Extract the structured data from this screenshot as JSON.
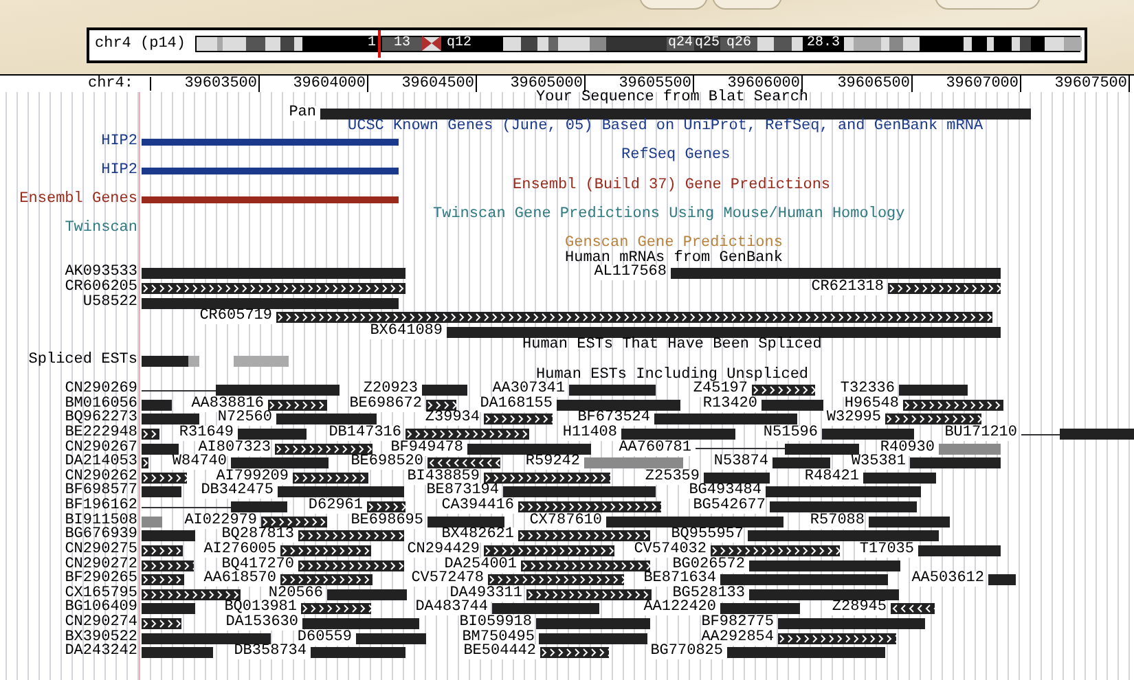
{
  "ideogram": {
    "label": "chr4 (p14)",
    "bands": [
      "1",
      "13",
      "q12",
      "q24",
      "q25",
      "q26",
      "28.3"
    ]
  },
  "ruler": {
    "label": "chr4:",
    "ticks": [
      "39603500",
      "39604000",
      "39604500",
      "39605000",
      "39605500",
      "39606000",
      "39606500",
      "39607000",
      "39607500"
    ]
  },
  "rows": [
    {
      "kind": "title",
      "text": "Your Sequence from Blat Search",
      "color": "#000000"
    },
    {
      "kind": "features",
      "items": [
        {
          "label": "Pan",
          "kind": "solid"
        }
      ]
    },
    {
      "kind": "title",
      "text": "UCSC Known Genes (June, 05) Based on UniProt, RefSeq, and GenBank mRNA",
      "color": "#1c3a8c"
    },
    {
      "kind": "features",
      "label": "HIP2",
      "color": "#1c3a8c",
      "items": [
        {
          "kind": "gene"
        }
      ]
    },
    {
      "kind": "title",
      "text": "RefSeq Genes",
      "color": "#1c3a8c"
    },
    {
      "kind": "features",
      "label": "HIP2",
      "color": "#1c3a8c",
      "items": [
        {
          "kind": "gene"
        }
      ]
    },
    {
      "kind": "title",
      "text": "Ensembl (Build 37) Gene Predictions",
      "color": "#9a2a1c"
    },
    {
      "kind": "features",
      "label": "Ensembl Genes",
      "color": "#9a2a1c",
      "items": [
        {
          "kind": "gene"
        }
      ]
    },
    {
      "kind": "title",
      "text": "Twinscan Gene Predictions Using Mouse/Human Homology",
      "color": "#2e7a80"
    },
    {
      "kind": "features",
      "label": "Twinscan",
      "color": "#2e7a80",
      "items": []
    },
    {
      "kind": "title",
      "text": "Genscan Gene Predictions",
      "color": "#b8823c"
    },
    {
      "kind": "title",
      "text": "Human mRNAs from GenBank",
      "color": "#000000"
    },
    {
      "kind": "features",
      "label": "AK093533",
      "items": [
        {
          "kind": "solid"
        },
        {
          "label": "AL117568",
          "kind": "solid"
        }
      ]
    },
    {
      "kind": "features",
      "label": "CR606205",
      "items": [
        {
          "kind": "fwd"
        },
        {
          "label": "CR621318",
          "kind": "fwd"
        }
      ]
    },
    {
      "kind": "features",
      "label": "U58522",
      "items": [
        {
          "kind": "solid"
        }
      ]
    },
    {
      "kind": "features",
      "items": [
        {
          "label": "CR605719",
          "kind": "fwd"
        }
      ]
    },
    {
      "kind": "features",
      "items": [
        {
          "label": "BX641089",
          "kind": "solid"
        }
      ]
    },
    {
      "kind": "title",
      "text": "Human ESTs That Have Been Spliced",
      "color": "#000000"
    },
    {
      "kind": "features",
      "label": "Spliced ESTs",
      "items": [
        {
          "kind": "solid"
        },
        {
          "kind": "gray"
        },
        {
          "kind": "gray"
        }
      ]
    },
    {
      "kind": "title",
      "text": "Human ESTs Including Unspliced",
      "color": "#000000"
    },
    {
      "kind": "features",
      "label": "CN290269",
      "items": [
        {
          "kind": "line"
        },
        {
          "label": "Z20923",
          "kind": "solid"
        },
        {
          "label": "AA307341",
          "kind": "solid"
        },
        {
          "label": "Z45197",
          "kind": "fwd"
        },
        {
          "label": "T32336",
          "kind": "solid"
        }
      ]
    },
    {
      "kind": "features",
      "label": "BM016056",
      "items": [
        {
          "kind": "solid"
        },
        {
          "label": "AA838816",
          "kind": "fwd"
        },
        {
          "label": "BE698672",
          "kind": "fwd"
        },
        {
          "label": "DA168155",
          "kind": "solid"
        },
        {
          "label": "R13420",
          "kind": "solid"
        },
        {
          "label": "H96548",
          "kind": "fwd"
        }
      ]
    },
    {
      "kind": "features",
      "label": "BQ962273",
      "items": [
        {
          "kind": "solid"
        },
        {
          "label": "N72560",
          "kind": "solid"
        },
        {
          "label": "Z39934",
          "kind": "fwd"
        },
        {
          "label": "BF673524",
          "kind": "solid"
        },
        {
          "label": "W32995",
          "kind": "fwd"
        }
      ]
    },
    {
      "kind": "features",
      "label": "BE222948",
      "items": [
        {
          "kind": "fwd"
        },
        {
          "label": "R31649",
          "kind": "solid"
        },
        {
          "label": "DB147316",
          "kind": "fwd"
        },
        {
          "label": "H11408",
          "kind": "solid"
        },
        {
          "label": "N51596",
          "kind": "solid"
        },
        {
          "label": "BU171210",
          "kind": "line"
        }
      ]
    },
    {
      "kind": "features",
      "label": "CN290267",
      "items": [
        {
          "kind": "solid"
        },
        {
          "label": "AI807323",
          "kind": "fwd"
        },
        {
          "label": "BF949478",
          "kind": "solid"
        },
        {
          "label": "AA760781",
          "kind": "line"
        },
        {
          "label": "R40930",
          "kind": "gray"
        }
      ]
    },
    {
      "kind": "features",
      "label": "DA214053",
      "items": [
        {
          "kind": "fwd"
        },
        {
          "label": "W84740",
          "kind": "solid"
        },
        {
          "label": "BE698520",
          "kind": "rev"
        },
        {
          "label": "R59242",
          "kind": "gray"
        },
        {
          "label": "N53874",
          "kind": "solid"
        },
        {
          "label": "W35381",
          "kind": "solid"
        }
      ]
    },
    {
      "kind": "features",
      "label": "CN290262",
      "items": [
        {
          "kind": "fwd"
        },
        {
          "label": "AI799209",
          "kind": "fwd"
        },
        {
          "label": "BI438859",
          "kind": "fwd"
        },
        {
          "label": "Z25359",
          "kind": "solid"
        },
        {
          "label": "R48421",
          "kind": "solid"
        }
      ]
    },
    {
      "kind": "features",
      "label": "BF698577",
      "items": [
        {
          "kind": "solid"
        },
        {
          "label": "DB342475",
          "kind": "solid"
        },
        {
          "label": "BE873194",
          "kind": "solid"
        },
        {
          "label": "BG493484",
          "kind": "solid"
        }
      ]
    },
    {
      "kind": "features",
      "label": "BF196162",
      "items": [
        {
          "kind": "line"
        },
        {
          "label": "D62961",
          "kind": "fwd"
        },
        {
          "label": "CA394416",
          "kind": "fwd"
        },
        {
          "label": "BG542677",
          "kind": "solid"
        }
      ]
    },
    {
      "kind": "features",
      "label": "BI911508",
      "items": [
        {
          "kind": "gray"
        },
        {
          "label": "AI022979",
          "kind": "fwd"
        },
        {
          "label": "BE698695",
          "kind": "solid"
        },
        {
          "label": "CX787610",
          "kind": "solid"
        },
        {
          "label": "R57088",
          "kind": "solid"
        }
      ]
    },
    {
      "kind": "features",
      "label": "BG676939",
      "items": [
        {
          "kind": "solid"
        },
        {
          "label": "BQ287813",
          "kind": "fwd"
        },
        {
          "label": "BX482621",
          "kind": "fwd"
        },
        {
          "label": "BQ955957",
          "kind": "solid"
        }
      ]
    },
    {
      "kind": "features",
      "label": "CN290275",
      "items": [
        {
          "kind": "fwd"
        },
        {
          "label": "AI276005",
          "kind": "fwd"
        },
        {
          "label": "CN294429",
          "kind": "fwd"
        },
        {
          "label": "CV574032",
          "kind": "fwd"
        },
        {
          "label": "T17035",
          "kind": "solid"
        }
      ]
    },
    {
      "kind": "features",
      "label": "CN290272",
      "items": [
        {
          "kind": "fwd"
        },
        {
          "label": "BQ417270",
          "kind": "fwd"
        },
        {
          "label": "DA254001",
          "kind": "fwd"
        },
        {
          "label": "BG026572",
          "kind": "solid"
        }
      ]
    },
    {
      "kind": "features",
      "label": "BF290265",
      "items": [
        {
          "kind": "fwd"
        },
        {
          "label": "AA618570",
          "kind": "fwd"
        },
        {
          "label": "CV572478",
          "kind": "fwd"
        },
        {
          "label": "BE871634",
          "kind": "solid"
        },
        {
          "label": "AA503612",
          "kind": "solid"
        }
      ]
    },
    {
      "kind": "features",
      "label": "CX165795",
      "items": [
        {
          "kind": "fwd"
        },
        {
          "label": "N20566",
          "kind": "solid"
        },
        {
          "label": "DA493311",
          "kind": "fwd"
        },
        {
          "label": "BG528133",
          "kind": "solid"
        }
      ]
    },
    {
      "kind": "features",
      "label": "BG106409",
      "items": [
        {
          "kind": "solid"
        },
        {
          "label": "BQ013981",
          "kind": "fwd"
        },
        {
          "label": "DA483744",
          "kind": "solid"
        },
        {
          "label": "AA122420",
          "kind": "solid"
        },
        {
          "label": "Z28945",
          "kind": "rev"
        }
      ]
    },
    {
      "kind": "features",
      "label": "CN290274",
      "items": [
        {
          "kind": "fwd"
        },
        {
          "label": "DA153630",
          "kind": "solid"
        },
        {
          "label": "BI059918",
          "kind": "solid"
        },
        {
          "label": "BF982775",
          "kind": "solid"
        }
      ]
    },
    {
      "kind": "features",
      "label": "BX390522",
      "items": [
        {
          "kind": "solid"
        },
        {
          "label": "D60559",
          "kind": "solid"
        },
        {
          "label": "BM750495",
          "kind": "solid"
        },
        {
          "label": "AA292854",
          "kind": "fwd"
        }
      ]
    },
    {
      "kind": "features",
      "label": "DA243242",
      "items": [
        {
          "kind": "solid"
        },
        {
          "label": "DB358734",
          "kind": "solid"
        },
        {
          "label": "BE504442",
          "kind": "fwd"
        },
        {
          "label": "BG770825",
          "kind": "solid"
        }
      ]
    }
  ]
}
